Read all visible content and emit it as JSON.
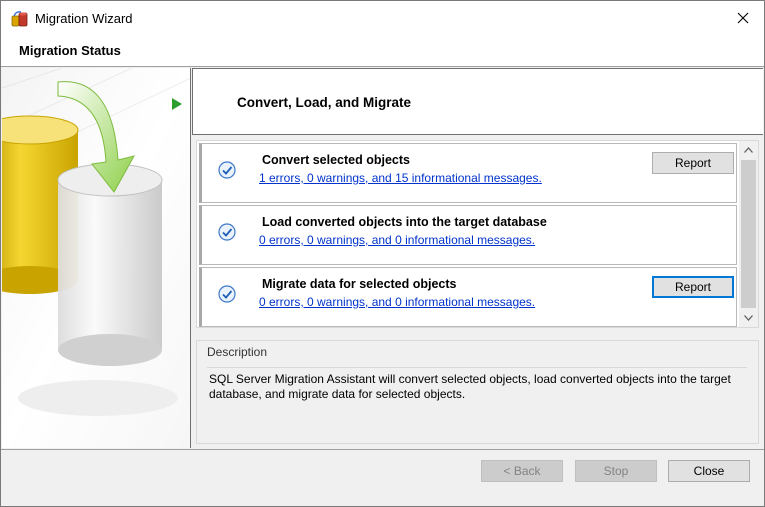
{
  "window": {
    "title": "Migration Wizard",
    "header_title": "Migration Status"
  },
  "step": {
    "title": "Convert, Load, and Migrate"
  },
  "tasks": [
    {
      "title": "Convert selected objects",
      "link": "1 errors, 0 warnings, and 15 informational messages.",
      "button": "Report",
      "focused": false
    },
    {
      "title": "Load converted objects into the target database",
      "link": "0 errors, 0 warnings, and 0 informational messages."
    },
    {
      "title": "Migrate data for selected objects",
      "link": "0 errors, 0 warnings, and 0 informational messages.",
      "button": "Report",
      "focused": true
    }
  ],
  "description": {
    "label": "Description",
    "text": "SQL Server Migration Assistant will convert selected objects, load converted objects into the target database, and migrate data for selected objects."
  },
  "footer": {
    "back": "< Back",
    "stop": "Stop",
    "close": "Close"
  },
  "colors": {
    "link": "#0033cc",
    "focus": "#0078d7",
    "step_arrow": "#2e9e2e"
  }
}
